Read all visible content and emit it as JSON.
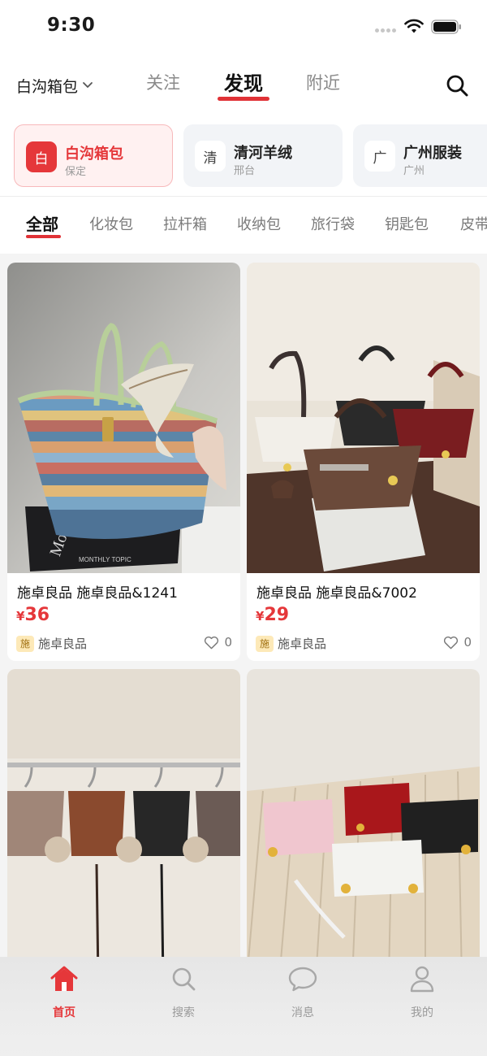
{
  "status_bar": {
    "time": "9:30"
  },
  "header": {
    "region": "白沟箱包",
    "tabs": [
      {
        "label": "关注",
        "active": false
      },
      {
        "label": "发现",
        "active": true
      },
      {
        "label": "附近",
        "active": false
      }
    ],
    "search_icon": "search-icon"
  },
  "shops": [
    {
      "avatar": "白",
      "name": "白沟箱包",
      "city": "保定",
      "active": true
    },
    {
      "avatar": "清",
      "name": "清河羊绒",
      "city": "邢台",
      "active": false
    },
    {
      "avatar": "广",
      "name": "广州服装",
      "city": "广州",
      "active": false
    }
  ],
  "categories": [
    "全部",
    "化妆包",
    "拉杆箱",
    "收纳包",
    "旅行袋",
    "钥匙包",
    "皮带"
  ],
  "products": [
    {
      "title": "施卓良品 施卓良品&1241",
      "currency": "¥",
      "price": "36",
      "seller_badge": "施",
      "seller": "施卓良品",
      "likes": "0"
    },
    {
      "title": "施卓良品 施卓良品&7002",
      "currency": "¥",
      "price": "29",
      "seller_badge": "施",
      "seller": "施卓良品",
      "likes": "0"
    },
    {
      "title": "",
      "currency": "",
      "price": "",
      "seller_badge": "",
      "seller": "",
      "likes": ""
    },
    {
      "title": "",
      "currency": "",
      "price": "",
      "seller_badge": "",
      "seller": "",
      "likes": ""
    }
  ],
  "bottom_nav": [
    {
      "label": "首页",
      "icon": "home-icon",
      "active": true
    },
    {
      "label": "搜索",
      "icon": "search-icon",
      "active": false
    },
    {
      "label": "消息",
      "icon": "message-icon",
      "active": false
    },
    {
      "label": "我的",
      "icon": "profile-icon",
      "active": false
    }
  ],
  "colors": {
    "accent": "#e5373a",
    "feed_bg": "#f4f4f4",
    "active_shop_bg": "#fff1f1"
  }
}
